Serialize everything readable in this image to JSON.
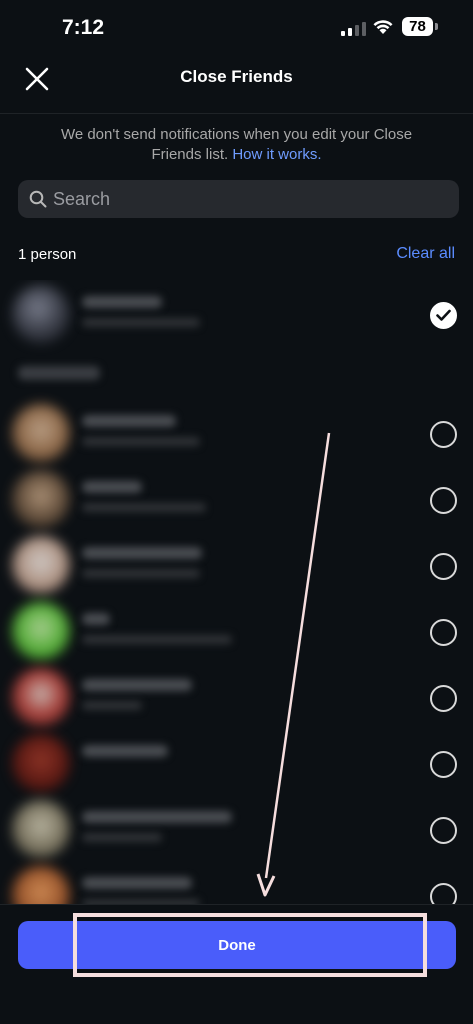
{
  "status_bar": {
    "time": "7:12",
    "battery": "78"
  },
  "header": {
    "title": "Close Friends"
  },
  "notice": {
    "text": "We don't send notifications when you edit your Close Friends list.",
    "link": "How it works."
  },
  "search": {
    "placeholder": "Search"
  },
  "list_header": {
    "count": "1 person",
    "clear_all": "Clear all"
  },
  "rows": [
    {
      "checked": true
    },
    {
      "checked": false
    },
    {
      "checked": false
    },
    {
      "checked": false
    },
    {
      "checked": false
    },
    {
      "checked": false
    },
    {
      "checked": false
    },
    {
      "checked": false
    },
    {
      "checked": false
    }
  ],
  "footer": {
    "done_label": "Done"
  },
  "colors": {
    "accent": "#4a5dfa",
    "link": "#5b8cff",
    "background": "#0c1014"
  }
}
